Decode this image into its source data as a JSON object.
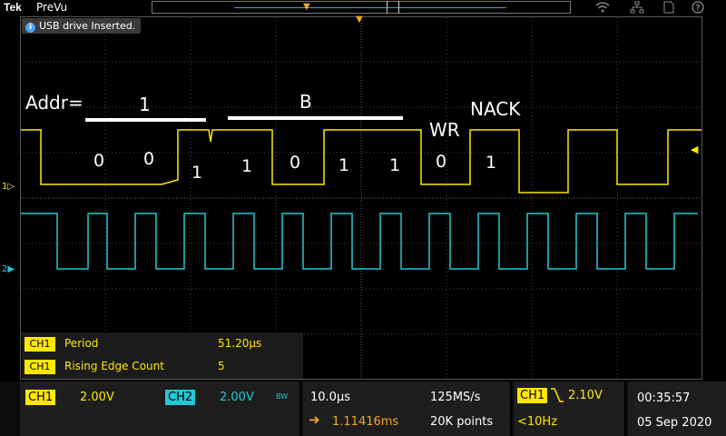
{
  "colors": {
    "ch1": "#ffe800",
    "ch2": "#23c8d6",
    "trigger": "#f5a623",
    "background": "#000000"
  },
  "topbar": {
    "brand": "Tek",
    "mode": "PreVu",
    "icons": [
      "wifi-icon",
      "network-icon",
      "file-icon",
      "help-icon"
    ]
  },
  "notice": {
    "text": "USB drive Inserted."
  },
  "annotations": {
    "addr": "Addr=",
    "hex_first": "1",
    "hex_second": "B",
    "wr": "WR",
    "nack": "NACK",
    "bits": [
      "0",
      "0",
      "1",
      "1",
      "0",
      "1",
      "1",
      "0",
      "1"
    ]
  },
  "channel_markers": {
    "ch1": "1",
    "ch2": "2"
  },
  "measurements": [
    {
      "channel": "CH1",
      "name": "Period",
      "value": "51.20µs"
    },
    {
      "channel": "CH1",
      "name": "Rising Edge Count",
      "value": "5"
    }
  ],
  "status": {
    "ch1_label": "CH1",
    "ch1_scale": "2.00V",
    "ch2_label": "CH2",
    "ch2_scale": "2.00V",
    "bw_label": "BW",
    "horizontal_scale": "10.0µs",
    "sample_rate": "125MS/s",
    "delay": "1.11416ms",
    "record_length": "20K points",
    "trigger_channel": "CH1",
    "trigger_level": "2.10V",
    "trigger_freq": "<10Hz",
    "time": "00:35:57",
    "date": "05 Sep 2020"
  }
}
